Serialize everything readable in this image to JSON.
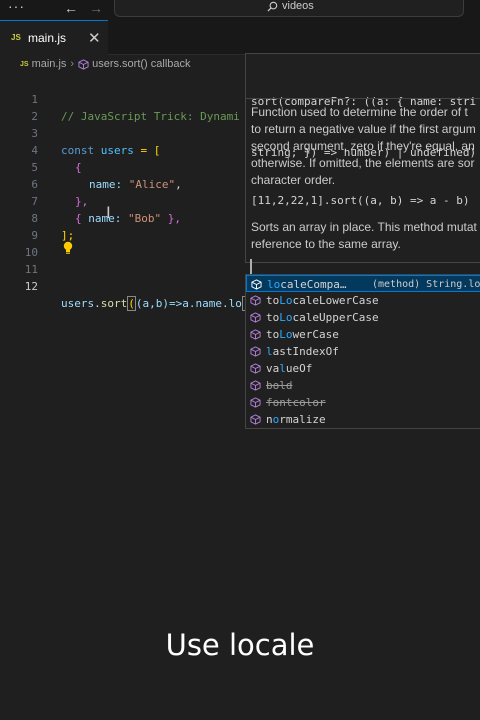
{
  "titlebar": {
    "menu": "···",
    "back": "←",
    "forward": "→",
    "search_text": "videos"
  },
  "tab": {
    "icon_text": "JS",
    "label": "main.js",
    "close": "✕"
  },
  "breadcrumb": {
    "icon_text": "JS",
    "file": "main.js",
    "separator": "›",
    "symbol": "users.sort() callback"
  },
  "editor": {
    "lines": [
      {
        "n": "1",
        "t": "// JavaScript Trick: Dynami"
      },
      {
        "n": "2",
        "t": ""
      },
      {
        "n": "3",
        "kw": "const",
        "var": "users",
        "rest": " = ["
      },
      {
        "n": "4",
        "t": "{"
      },
      {
        "n": "5",
        "prop": "name:",
        "str": "\"Alice\"",
        "rest": ","
      },
      {
        "n": "6",
        "t": "},"
      },
      {
        "n": "7",
        "open": "{",
        "prop": "name:",
        "str": "\"Bob\"",
        "close": "},"
      },
      {
        "n": "8",
        "t": "];"
      },
      {
        "n": "9",
        "t": ""
      },
      {
        "n": "10",
        "t": ""
      },
      {
        "n": "11",
        "t": ""
      },
      {
        "n": "12",
        "p1": "users",
        "p2": ".",
        "fn": "sort",
        "p3": "(",
        "p4": "(a,b)=>a.name.lo",
        "p5": ")"
      }
    ]
  },
  "hover": {
    "signature_line1": "sort(compareFn?: ((a: { name: stri",
    "signature_line2": "string; }) => number) | undefined)",
    "doc": "Function used to determine the order of the elements. It is expected to return a negative value if the first argument is less than the second argument, zero if they're equal, and a positive value otherwise. If omitted, the elements are sorted in ascending, ASCII character order.",
    "doc_lines": [
      "Function used to determine the order of t",
      "to return a negative value if the first argum",
      "second argument, zero if they're equal, an",
      "otherwise. If omitted, the elements are sor",
      "character order."
    ],
    "example": "[11,2,22,1].sort((a, b) => a - b)",
    "sort_lines": [
      "Sorts an array in place. This method mutat",
      "reference to the same array."
    ]
  },
  "suggest": {
    "items": [
      {
        "match": "lo",
        "rest": "caleCompa…",
        "detail": "(method) String.loc",
        "deprecated": false,
        "selected": true
      },
      {
        "pre": "to",
        "match": "Lo",
        "rest": "caleLowerCase",
        "deprecated": false
      },
      {
        "pre": "to",
        "match": "Lo",
        "rest": "caleUpperCase",
        "deprecated": false
      },
      {
        "pre": "to",
        "match": "Lo",
        "rest": "werCase",
        "deprecated": false
      },
      {
        "pre": "",
        "match": "l",
        "rest": "astIndexOf",
        "deprecated": false
      },
      {
        "pre": "va",
        "match": "l",
        "rest": "ueOf",
        "deprecated": false
      },
      {
        "pre": "",
        "match": "",
        "rest": "bold",
        "deprecated": true
      },
      {
        "pre": "",
        "match": "",
        "rest": "fontcolor",
        "deprecated": true
      },
      {
        "pre": "n",
        "match": "o",
        "rest": "rmalize",
        "deprecated": false
      }
    ]
  },
  "caption": "Use locale",
  "colors": {
    "background": "#1f1f1f",
    "accent": "#0078d4",
    "highlight": "#2aaaff",
    "method_icon": "#b180d7"
  },
  "icons": {
    "menu": "more-icon",
    "search": "search-icon",
    "bulb": "lightbulb-icon",
    "method": "method-cube-icon"
  }
}
